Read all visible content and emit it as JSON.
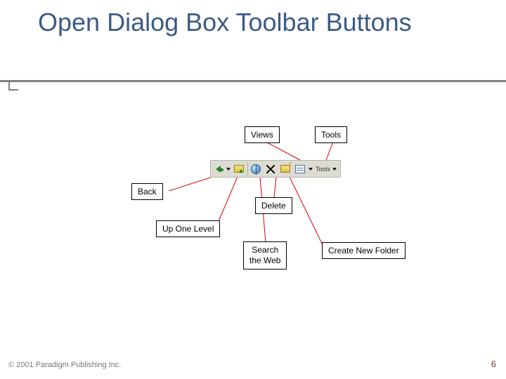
{
  "title": "Open Dialog Box Toolbar Buttons",
  "callouts": {
    "views": "Views",
    "tools": "Tools",
    "back": "Back",
    "delete": "Delete",
    "up_one_level": "Up One Level",
    "search_line1": "Search",
    "search_line2": "the Web",
    "create_new_folder": "Create New Folder"
  },
  "toolbar": {
    "buttons": [
      {
        "id": "back",
        "label": "Back",
        "has_dropdown": true
      },
      {
        "id": "up_one_level",
        "label": "Up One Level"
      },
      {
        "id": "search_web",
        "label": "Search the Web"
      },
      {
        "id": "delete",
        "label": "Delete"
      },
      {
        "id": "create_new_folder",
        "label": "Create New Folder"
      },
      {
        "id": "views",
        "label": "Views",
        "has_dropdown": true
      },
      {
        "id": "tools",
        "label": "Tools",
        "has_dropdown": true
      }
    ],
    "tools_label": "Tools"
  },
  "footer": {
    "copyright": "© 2001 Paradigm Publishing Inc.",
    "page_number": "6"
  },
  "colors": {
    "title": "#3c5a86",
    "divider": "#808080",
    "connector": "#d40000",
    "toolbar_bg": "#dcdcd4"
  }
}
